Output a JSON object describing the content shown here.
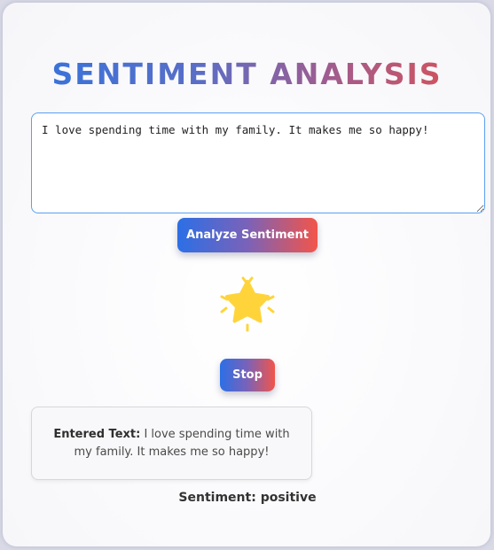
{
  "app": {
    "title_part1": "SENTIMENT",
    "title_part2": "ANALYSIS"
  },
  "input": {
    "value": "I love spending time with my family. It makes me so happy!"
  },
  "buttons": {
    "analyze_label": "Analyze Sentiment",
    "stop_label": "Stop"
  },
  "result": {
    "entered_label": "Entered Text:",
    "entered_text": "I love spending time with my family. It makes me so happy!",
    "sentiment_label": "Sentiment:",
    "sentiment_value": "positive"
  },
  "icons": {
    "result_icon": "star-icon"
  },
  "colors": {
    "gradient_start": "#2c6fe6",
    "gradient_end": "#f2554a",
    "star": "#ffd43b",
    "input_border": "#5a9ff0"
  }
}
